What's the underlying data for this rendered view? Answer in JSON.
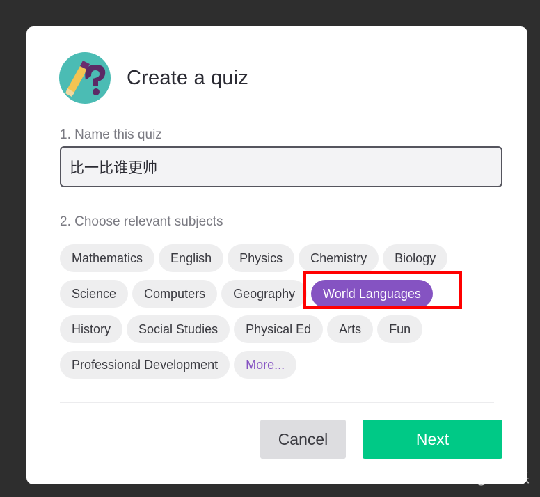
{
  "dialog": {
    "title": "Create a quiz",
    "logo_icon": "quiz-pencil-question-icon"
  },
  "name_step": {
    "label": "1. Name this quiz",
    "value": "比一比谁更帅"
  },
  "subjects_step": {
    "label": "2. Choose relevant subjects",
    "rows": [
      [
        {
          "label": "Mathematics",
          "selected": false
        },
        {
          "label": "English",
          "selected": false
        },
        {
          "label": "Physics",
          "selected": false
        },
        {
          "label": "Chemistry",
          "selected": false
        },
        {
          "label": "Biology",
          "selected": false
        }
      ],
      [
        {
          "label": "Science",
          "selected": false
        },
        {
          "label": "Computers",
          "selected": false
        },
        {
          "label": "Geography",
          "selected": false
        },
        {
          "label": "World Languages",
          "selected": true
        }
      ],
      [
        {
          "label": "History",
          "selected": false
        },
        {
          "label": "Social Studies",
          "selected": false
        },
        {
          "label": "Physical Ed",
          "selected": false
        },
        {
          "label": "Arts",
          "selected": false
        },
        {
          "label": "Fun",
          "selected": false
        }
      ],
      [
        {
          "label": "Professional Development",
          "selected": false
        },
        {
          "label": "More...",
          "selected": false,
          "more": true
        }
      ]
    ]
  },
  "footer": {
    "cancel_label": "Cancel",
    "next_label": "Next"
  },
  "watermark": "知乎 @江南乐",
  "colors": {
    "selected_chip": "#8553c2",
    "next_button": "#00c986",
    "highlight_box": "#ff0000",
    "backdrop": "#2e2e2e"
  }
}
